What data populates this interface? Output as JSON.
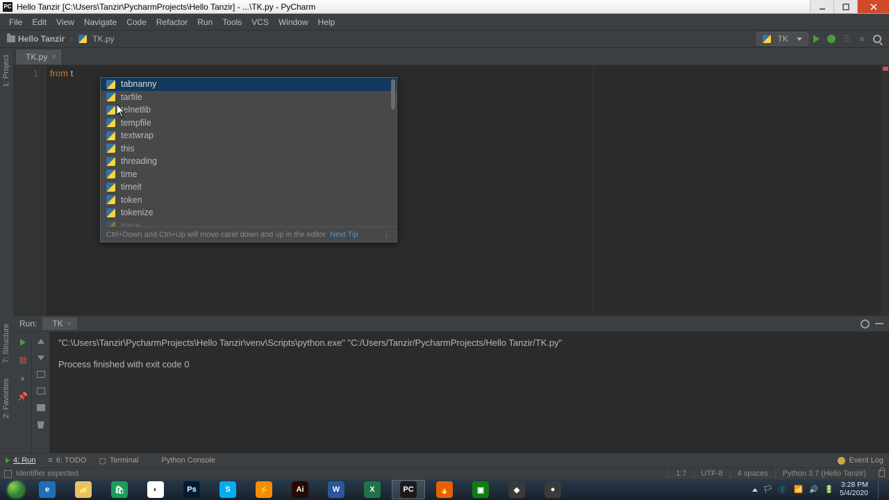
{
  "window": {
    "title": "Hello Tanzir [C:\\Users\\Tanzir\\PycharmProjects\\Hello Tanzir] - ...\\TK.py - PyCharm"
  },
  "menubar": [
    "File",
    "Edit",
    "View",
    "Navigate",
    "Code",
    "Refactor",
    "Run",
    "Tools",
    "VCS",
    "Window",
    "Help"
  ],
  "breadcrumb": {
    "project": "Hello Tanzir",
    "file": "TK.py"
  },
  "run_config": "TK",
  "editor_tab": {
    "name": "TK.py"
  },
  "line_no": "1",
  "code": {
    "keyword": "from",
    "typed": " t"
  },
  "completion": {
    "items": [
      "tabnanny",
      "tarfile",
      "telnetlib",
      "tempfile",
      "textwrap",
      "this",
      "threading",
      "time",
      "timeit",
      "token",
      "tokenize",
      "trace"
    ],
    "selected": 0,
    "hint": "Ctrl+Down and Ctrl+Up will move caret down and up in the editor",
    "next_tip": "Next Tip"
  },
  "left_tabs": {
    "project": "1: Project"
  },
  "side_tabs": {
    "structure": "7: Structure",
    "favorites": "2: Favorites"
  },
  "run_panel": {
    "header": "Run:",
    "tab": "TK",
    "line1": "\"C:\\Users\\Tanzir\\PycharmProjects\\Hello Tanzir\\venv\\Scripts\\python.exe\" \"C:/Users/Tanzir/PycharmProjects/Hello Tanzir/TK.py\"",
    "line2": "Process finished with exit code 0"
  },
  "bottom_tabs": {
    "run": "4: Run",
    "todo": "6: TODO",
    "terminal": "Terminal",
    "console": "Python Console",
    "event_log": "Event Log"
  },
  "status": {
    "msg": "Identifier expected",
    "pos": "1:7",
    "enc": "UTF-8",
    "indent": "4 spaces",
    "interp": "Python 3.7 (Hello Tanzir)"
  },
  "taskbar": {
    "apps": [
      {
        "name": "ie",
        "bg": "#1e6fb8",
        "label": "e"
      },
      {
        "name": "explorer",
        "bg": "#e8c268",
        "label": "📁"
      },
      {
        "name": "store",
        "bg": "#1a9e58",
        "label": "🛍"
      },
      {
        "name": "chrome",
        "bg": "#ffffff",
        "label": "◐"
      },
      {
        "name": "photoshop",
        "bg": "#001d33",
        "label": "Ps"
      },
      {
        "name": "skype",
        "bg": "#00aff0",
        "label": "S"
      },
      {
        "name": "vlc",
        "bg": "#f48c06",
        "label": "⚡"
      },
      {
        "name": "illustrator",
        "bg": "#2a0a00",
        "label": "Ai"
      },
      {
        "name": "word",
        "bg": "#2b579a",
        "label": "W"
      },
      {
        "name": "excel",
        "bg": "#217346",
        "label": "X"
      },
      {
        "name": "pycharm",
        "bg": "#1b1b1b",
        "label": "PC",
        "active": true
      },
      {
        "name": "firefox",
        "bg": "#e66000",
        "label": "🔥"
      },
      {
        "name": "xbox",
        "bg": "#107c10",
        "label": "▣"
      },
      {
        "name": "camtasia",
        "bg": "#3a3a3a",
        "label": "◆"
      },
      {
        "name": "recorder",
        "bg": "#3a3a3a",
        "label": "●"
      }
    ],
    "time": "3:28 PM",
    "date": "5/4/2020"
  }
}
